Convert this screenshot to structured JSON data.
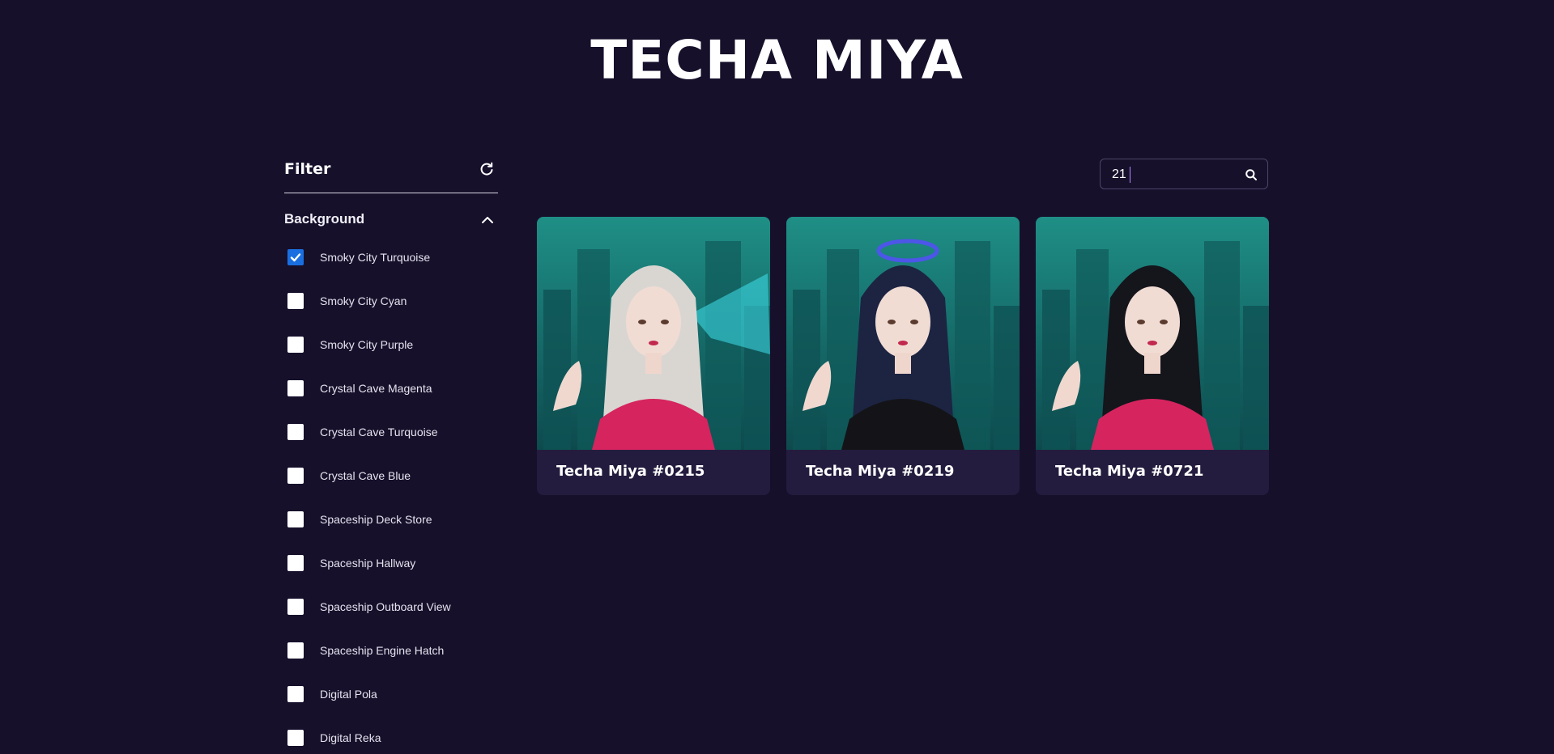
{
  "site": {
    "title": "TECHA MIYA"
  },
  "filter": {
    "title": "Filter",
    "reset_icon": "refresh-icon",
    "sections": [
      {
        "title": "Background",
        "expanded": true,
        "options": [
          {
            "label": "Smoky City Turquoise",
            "checked": true
          },
          {
            "label": "Smoky City Cyan",
            "checked": false
          },
          {
            "label": "Smoky City Purple",
            "checked": false
          },
          {
            "label": "Crystal Cave Magenta",
            "checked": false
          },
          {
            "label": "Crystal Cave Turquoise",
            "checked": false
          },
          {
            "label": "Crystal Cave Blue",
            "checked": false
          },
          {
            "label": "Spaceship Deck Store",
            "checked": false
          },
          {
            "label": "Spaceship Hallway",
            "checked": false
          },
          {
            "label": "Spaceship Outboard View",
            "checked": false
          },
          {
            "label": "Spaceship Engine Hatch",
            "checked": false
          },
          {
            "label": "Digital Pola",
            "checked": false
          },
          {
            "label": "Digital Reka",
            "checked": false
          }
        ]
      }
    ]
  },
  "search": {
    "value": "21",
    "icon": "search-icon"
  },
  "results": [
    {
      "name": "Techa Miya #0215",
      "hair": "#d9d6d2",
      "top": "#d6245f",
      "accent": "#3fe2ee"
    },
    {
      "name": "Techa Miya #0219",
      "hair": "#1c2442",
      "top": "#141418",
      "accent": "#4c56e8"
    },
    {
      "name": "Techa Miya #0721",
      "hair": "#15151c",
      "top": "#d6245f",
      "accent": "#e8a2c6"
    }
  ],
  "colors": {
    "background": "#16102b",
    "card": "#241c3e",
    "checkbox_checked": "#1a6fe0",
    "art_sky_top": "#1f8f86",
    "art_sky_bottom": "#0d4a4e"
  }
}
